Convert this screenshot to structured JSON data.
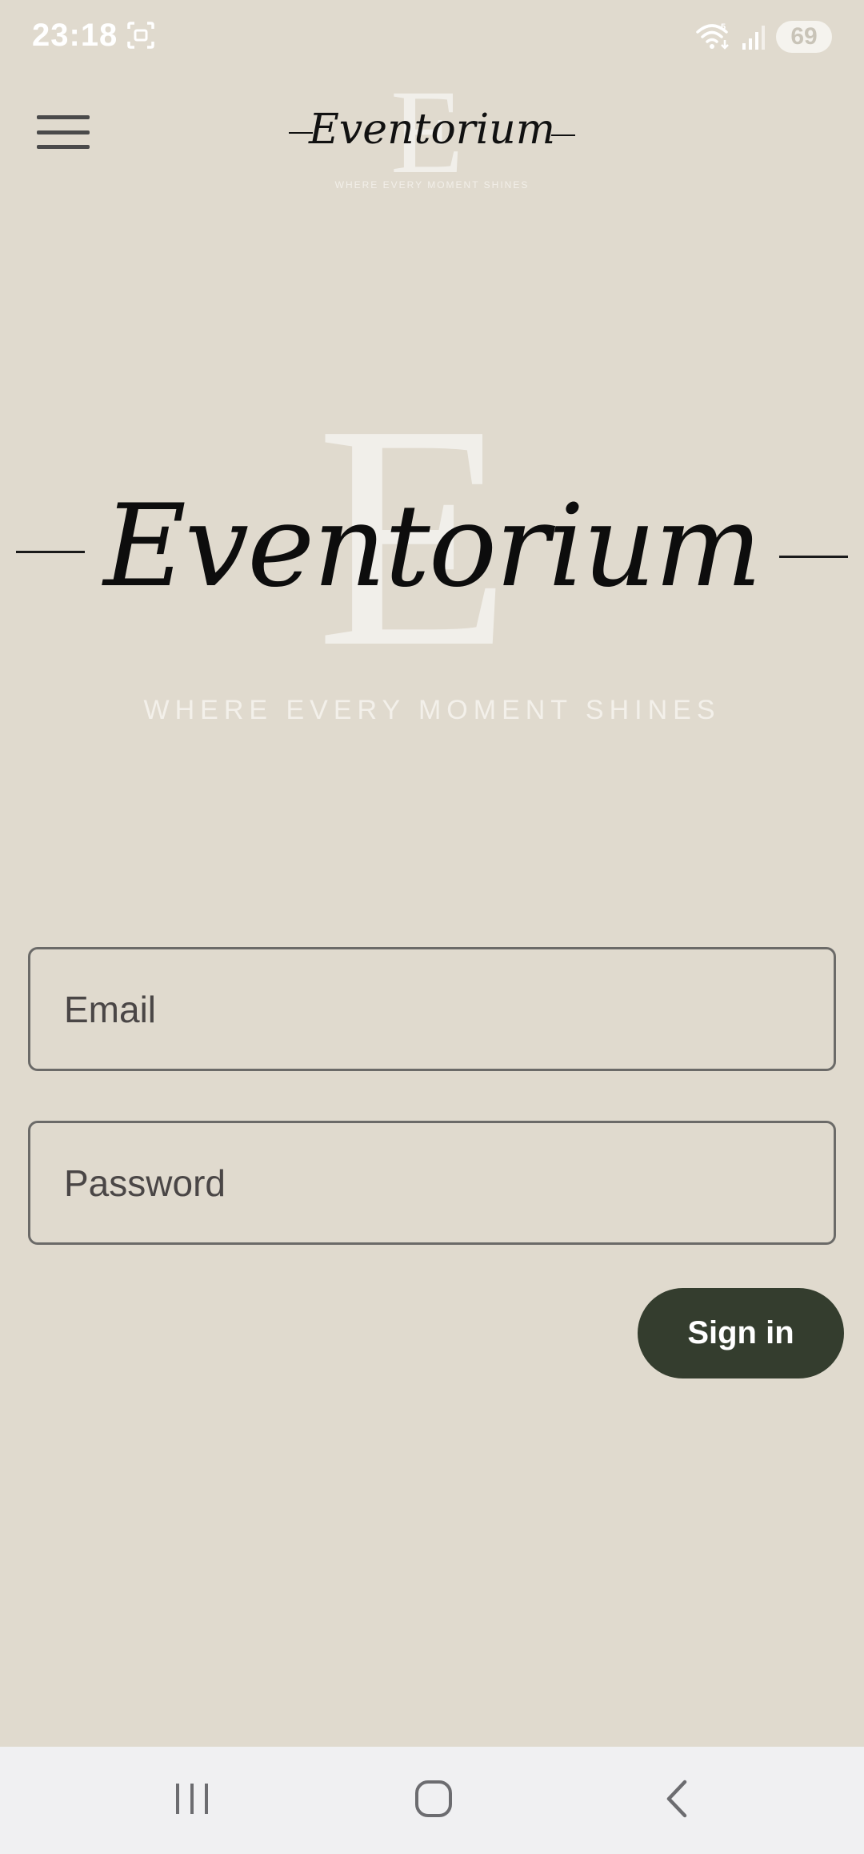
{
  "status_bar": {
    "time": "23:18",
    "battery": "69",
    "icons": [
      "screenshot-icon",
      "wifi-icon",
      "signal-icon",
      "battery-icon"
    ]
  },
  "header": {
    "menu_icon": "hamburger-menu-icon",
    "logo": {
      "letter": "E",
      "wordmark": "Eventorium",
      "tagline": "WHERE EVERY MOMENT SHINES"
    }
  },
  "hero": {
    "letter": "E",
    "wordmark": "Eventorium",
    "tagline": "WHERE EVERY MOMENT SHINES"
  },
  "form": {
    "email_placeholder": "Email",
    "password_placeholder": "Password",
    "signin_label": "Sign in"
  },
  "nav": {
    "icons": [
      "recent-apps-icon",
      "home-icon",
      "back-icon"
    ]
  },
  "colors": {
    "background": "#e0dace",
    "button": "#343d2e",
    "field_border": "#6b6a68",
    "nav_bar": "#f0f0f2"
  }
}
